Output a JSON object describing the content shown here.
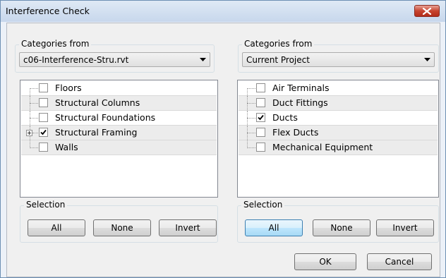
{
  "window": {
    "title": "Interference Check"
  },
  "left": {
    "categories_label": "Categories from",
    "categories_value": "c06-Interference-Stru.rvt",
    "items": [
      {
        "label": "Floors",
        "checked": false
      },
      {
        "label": "Structural Columns",
        "checked": false
      },
      {
        "label": "Structural Foundations",
        "checked": false
      },
      {
        "label": "Structural Framing",
        "checked": true
      },
      {
        "label": "Walls",
        "checked": false
      }
    ],
    "selection_label": "Selection",
    "buttons": {
      "all": "All",
      "none": "None",
      "invert": "Invert"
    }
  },
  "right": {
    "categories_label": "Categories from",
    "categories_value": "Current Project",
    "items": [
      {
        "label": "Air Terminals",
        "checked": false
      },
      {
        "label": "Duct Fittings",
        "checked": false
      },
      {
        "label": "Ducts",
        "checked": true
      },
      {
        "label": "Flex Ducts",
        "checked": false
      },
      {
        "label": "Mechanical Equipment",
        "checked": false
      }
    ],
    "selection_label": "Selection",
    "buttons": {
      "all": "All",
      "none": "None",
      "invert": "Invert"
    }
  },
  "footer": {
    "ok": "OK",
    "cancel": "Cancel"
  }
}
